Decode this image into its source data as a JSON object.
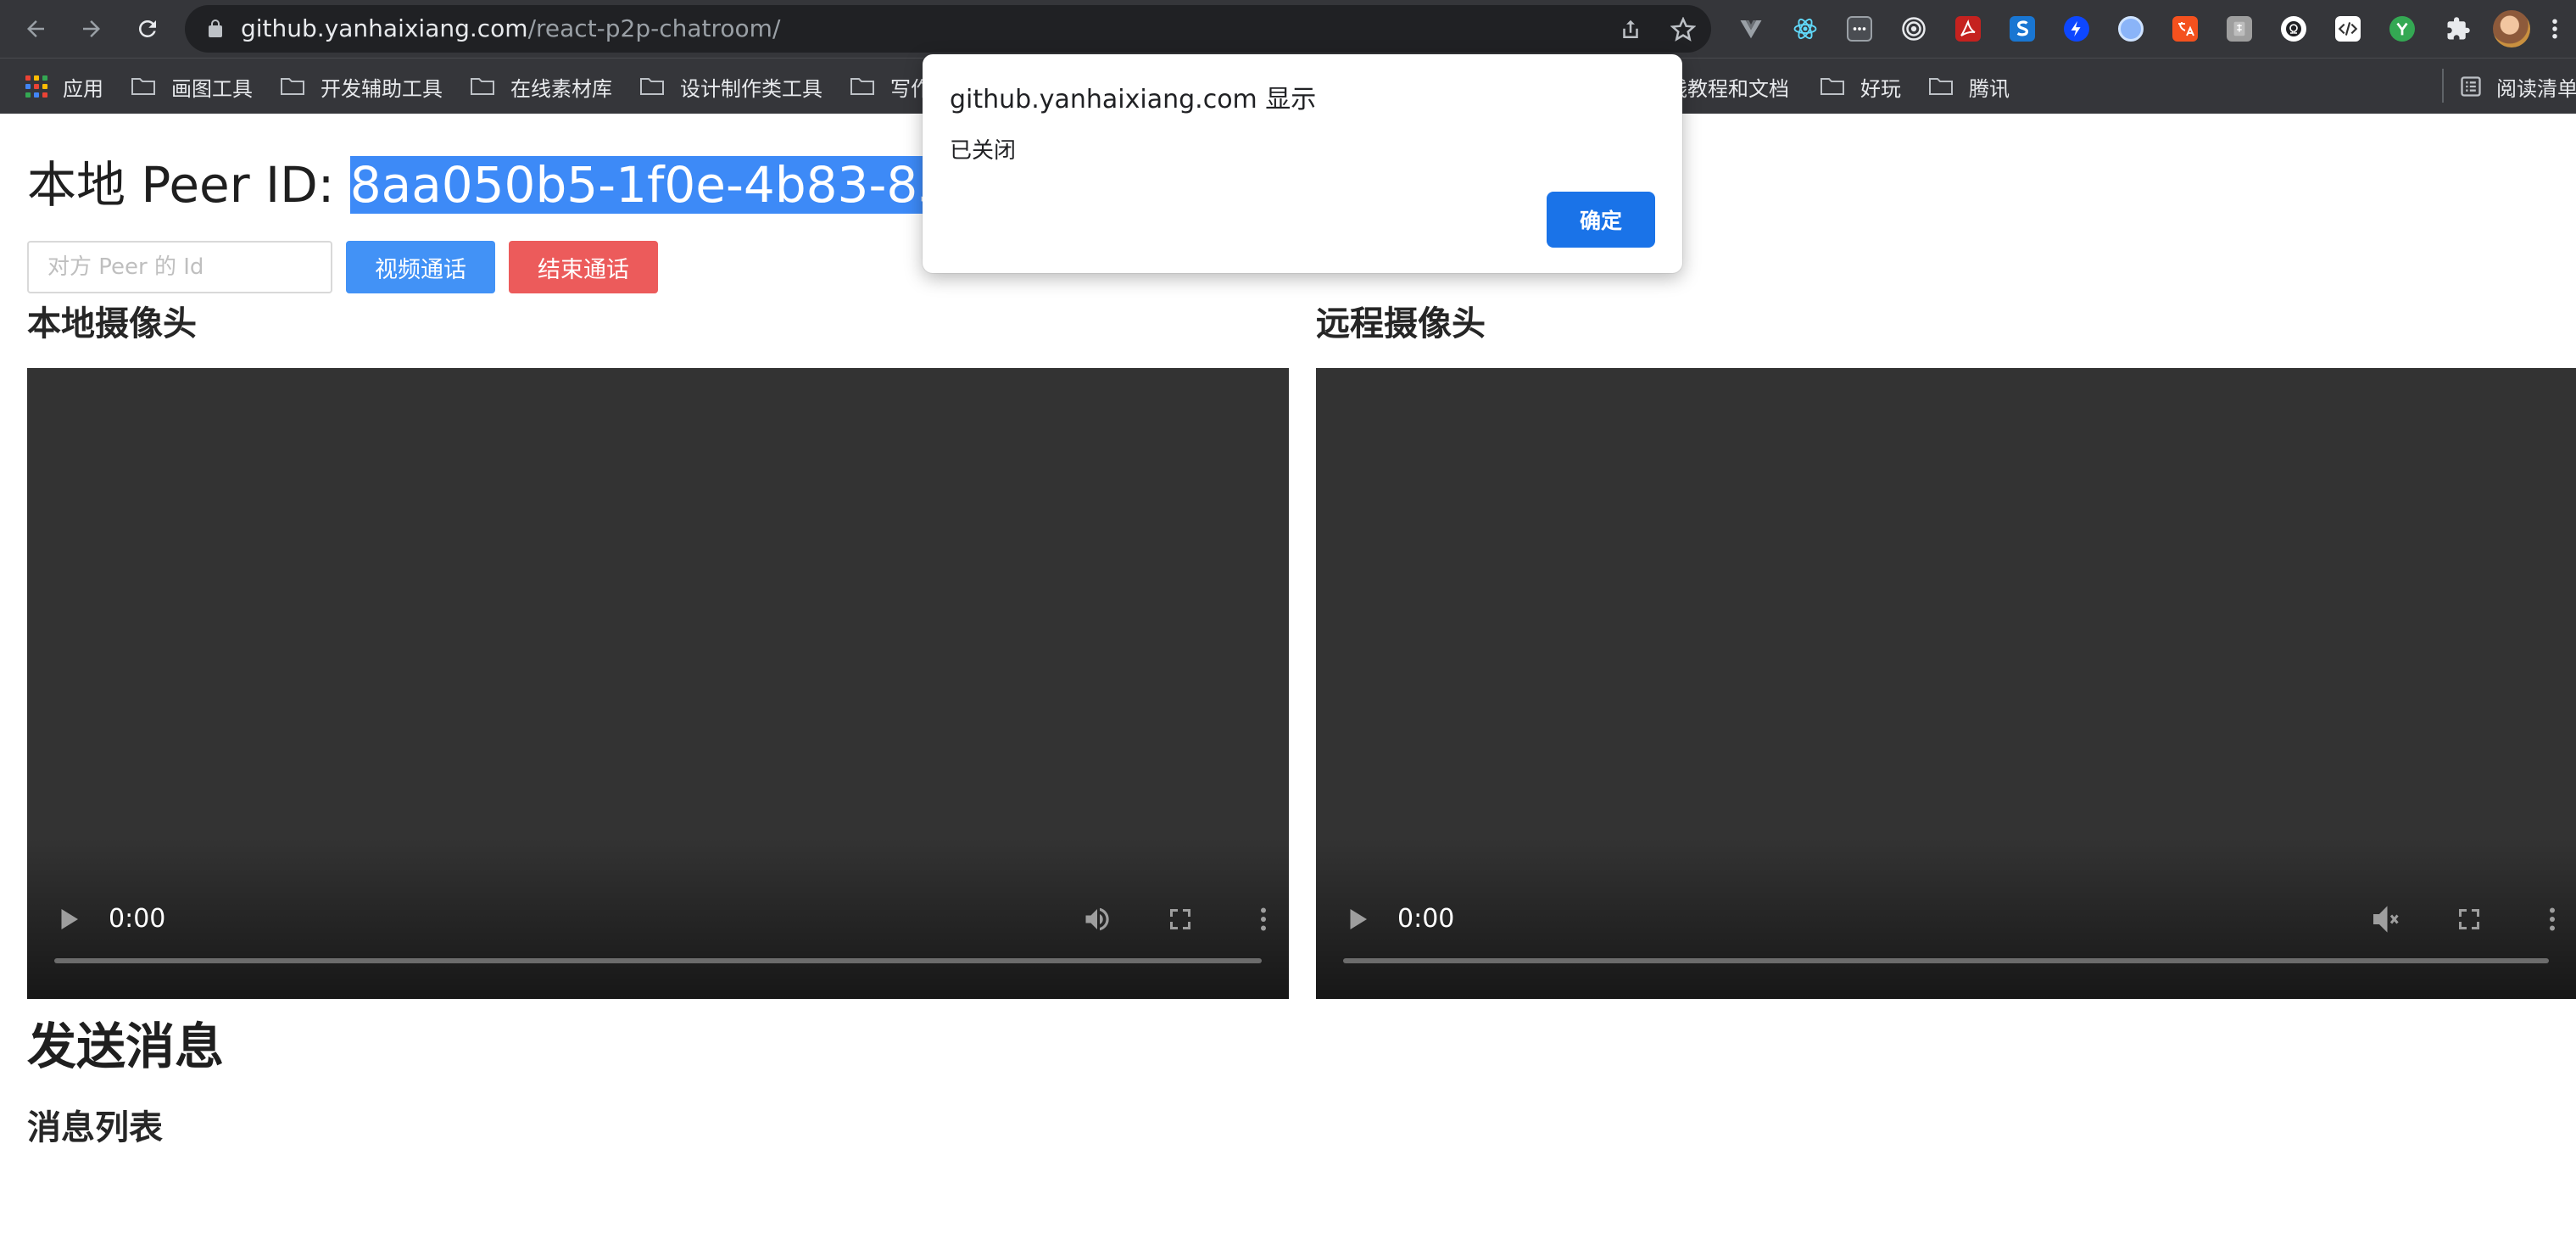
{
  "browser": {
    "url_host": "github.yanhaixiang.com",
    "url_path": "/react-p2p-chatroom/",
    "bookmarks": {
      "apps": "应用",
      "items": [
        "画图工具",
        "开发辅助工具",
        "在线素材库",
        "设计制作类工具",
        "写作"
      ],
      "items_right": [
        "线教程和文档",
        "好玩",
        "腾讯"
      ],
      "reading_list": "阅读清单"
    },
    "extensions": [
      "vue-devtools-icon",
      "react-devtools-icon",
      "dots-extension-icon",
      "target-extension-icon",
      "pdf-extension-icon",
      "s-extension-icon",
      "lightning-extension-icon",
      "circle-extension-icon",
      "translate-extension-icon",
      "mahjong-extension-icon",
      "omega-extension-icon",
      "code-extension-icon",
      "y-extension-icon",
      "puzzle-icon",
      "avatar",
      "menu-icon"
    ]
  },
  "page": {
    "peer_label": "本地 Peer ID: ",
    "peer_id": "8aa050b5-1f0e-4b83-857b",
    "input_placeholder": "对方 Peer 的 Id",
    "call_button": "视频通话",
    "end_button": "结束通话",
    "local_camera_title": "本地摄像头",
    "remote_camera_title": "远程摄像头",
    "local_video_time": "0:00",
    "remote_video_time": "0:00",
    "send_message_title": "发送消息",
    "message_list_title": "消息列表"
  },
  "dialog": {
    "title": "github.yanhaixiang.com 显示",
    "message": "已关闭",
    "ok_button": "确定"
  },
  "colors": {
    "chrome_bg": "#35363a",
    "omnibox_bg": "#202124",
    "selection": "#3d8af7",
    "call_button": "#4292f6",
    "end_button": "#ec5b5b",
    "dialog_ok": "#1a73e8",
    "video_bg": "#333333"
  }
}
